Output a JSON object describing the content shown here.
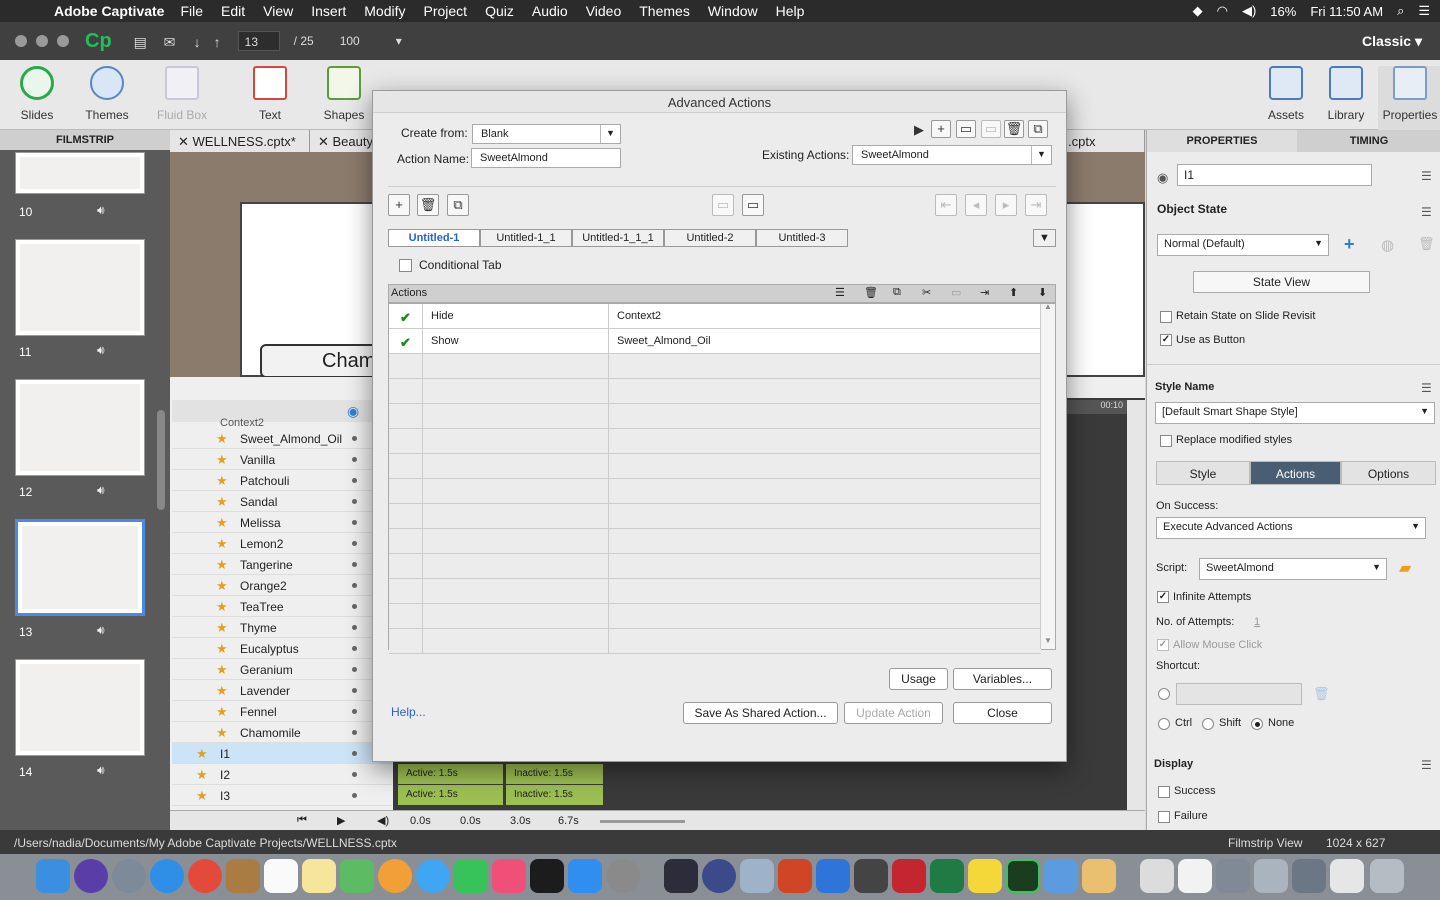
{
  "menubar": {
    "app": "Adobe Captivate",
    "items": [
      "File",
      "Edit",
      "View",
      "Insert",
      "Modify",
      "Project",
      "Quiz",
      "Audio",
      "Video",
      "Themes",
      "Window",
      "Help"
    ],
    "battery": "16%",
    "clock": "Fri 11:50 AM"
  },
  "titlebar": {
    "logo": "Cp",
    "page_current": "13",
    "page_total": "/ 25",
    "zoom": "100",
    "workspace": "Classic"
  },
  "toolbar": {
    "items": [
      {
        "label": "Slides",
        "icon": "add-slide-icon"
      },
      {
        "label": "Themes",
        "icon": "palette-icon"
      },
      {
        "label": "Fluid Box",
        "icon": "fluid-box-icon"
      },
      {
        "label": "Text",
        "icon": "text-icon"
      },
      {
        "label": "Shapes",
        "icon": "shapes-icon"
      },
      {
        "label": "Assets",
        "icon": "assets-icon"
      },
      {
        "label": "Library",
        "icon": "library-icon"
      },
      {
        "label": "Properties",
        "icon": "properties-icon"
      }
    ]
  },
  "filmstrip": {
    "header": "FILMSTRIP",
    "slides": [
      "10",
      "11",
      "12",
      "13",
      "14"
    ],
    "selected": "13"
  },
  "doc_tabs": [
    "WELLNESS.cptx*",
    "Beauty",
    ".cptx"
  ],
  "stage": {
    "button_text": "Cham"
  },
  "timeline": {
    "group": "Context2",
    "items": [
      "Sweet_Almond_Oil",
      "Vanilla",
      "Patchouli",
      "Sandal",
      "Melissa",
      "Lemon2",
      "Tangerine",
      "Orange2",
      "TeaTree",
      "Thyme",
      "Eucalyptus",
      "Geranium",
      "Lavender",
      "Fennel",
      "Chamomile",
      "I1",
      "I2",
      "I3"
    ],
    "bars": [
      {
        "active": "Active: 1.5s",
        "inactive": "Inactive: 1.5s"
      },
      {
        "active": "Active: 1.5s",
        "inactive": "Inactive: 1.5s"
      }
    ],
    "ruler_time": "00:10",
    "footer": {
      "t0": "0.0s",
      "t1": "0.0s",
      "t2": "3.0s",
      "t3": "6.7s"
    }
  },
  "properties": {
    "tabs": [
      "PROPERTIES",
      "TIMING"
    ],
    "name_value": "I1",
    "object_state_label": "Object State",
    "state_value": "Normal (Default)",
    "state_view_button": "State View",
    "retain_state": "Retain State on Slide Revisit",
    "use_as_button": "Use as Button",
    "style_name_label": "Style Name",
    "style_value": "[Default Smart Shape Style]",
    "replace_styles": "Replace modified styles",
    "segments": [
      "Style",
      "Actions",
      "Options"
    ],
    "on_success_label": "On Success:",
    "on_success_value": "Execute Advanced Actions",
    "script_label": "Script:",
    "script_value": "SweetAlmond",
    "infinite_attempts": "Infinite Attempts",
    "attempts_label": "No. of Attempts:",
    "attempts_value": "1",
    "allow_mouse": "Allow Mouse Click",
    "shortcut_label": "Shortcut:",
    "mod_ctrl": "Ctrl",
    "mod_shift": "Shift",
    "mod_none": "None",
    "display_label": "Display",
    "success": "Success",
    "failure": "Failure"
  },
  "status": {
    "path": "/Users/nadia/Documents/My Adobe Captivate Projects/WELLNESS.cptx",
    "view": "Filmstrip View",
    "size": "1024 x 627"
  },
  "dialog": {
    "title": "Advanced Actions",
    "create_from_label": "Create from:",
    "create_from_value": "Blank",
    "action_name_label": "Action Name:",
    "action_name_value": "SweetAlmond",
    "existing_label": "Existing Actions:",
    "existing_value": "SweetAlmond",
    "tabs": [
      "Untitled-1",
      "Untitled-1_1",
      "Untitled-1_1_1",
      "Untitled-2",
      "Untitled-3"
    ],
    "conditional_tab": "Conditional Tab",
    "actions_label": "Actions",
    "rows": [
      {
        "action": "Hide",
        "target": "Context2"
      },
      {
        "action": "Show",
        "target": "Sweet_Almond_Oil"
      }
    ],
    "usage": "Usage",
    "variables": "Variables...",
    "help": "Help...",
    "save_shared": "Save As Shared Action...",
    "update_action": "Update Action",
    "close": "Close"
  }
}
